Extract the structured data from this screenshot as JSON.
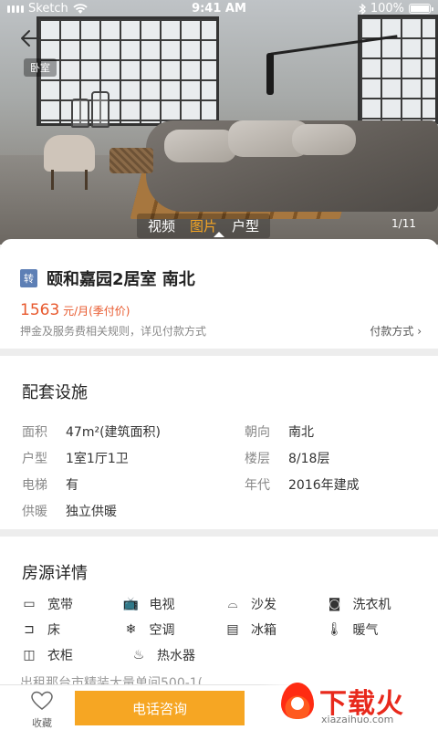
{
  "status_bar": {
    "carrier": "Sketch",
    "time": "9:41 AM",
    "battery": "100%",
    "battery_level": 1.0
  },
  "hero": {
    "room_tag": "卧室",
    "media_tabs": [
      {
        "label": "视频",
        "active": false
      },
      {
        "label": "图片",
        "active": true
      },
      {
        "label": "户型",
        "active": false
      }
    ],
    "counter": "1/11"
  },
  "listing": {
    "badge": "转",
    "title": "颐和嘉园2居室 南北",
    "price": "1563",
    "price_unit": " 元/月(季付价)",
    "policy_text": "押金及服务费相关规则，详见付款方式",
    "pay_link": "付款方式 ›"
  },
  "facilities": {
    "title": "配套设施",
    "rows": [
      [
        {
          "label": "面积",
          "value": "47m²(建筑面积)"
        },
        {
          "label": "朝向",
          "value": "南北"
        }
      ],
      [
        {
          "label": "户型",
          "value": "1室1厅1卫"
        },
        {
          "label": "楼层",
          "value": "8/18层"
        }
      ],
      [
        {
          "label": "电梯",
          "value": "有"
        },
        {
          "label": "年代",
          "value": "2016年建成"
        }
      ],
      [
        {
          "label": "供暖",
          "value": "独立供暖"
        }
      ]
    ]
  },
  "details": {
    "title": "房源详情",
    "amenities": [
      [
        {
          "icon": "broadband-icon",
          "glyph": "▭",
          "label": "宽带"
        },
        {
          "icon": "tv-icon",
          "glyph": "📺",
          "label": "电视"
        },
        {
          "icon": "sofa-icon",
          "glyph": "⌓",
          "label": "沙发"
        },
        {
          "icon": "washer-icon",
          "glyph": "◙",
          "label": "洗衣机"
        }
      ],
      [
        {
          "icon": "bed-icon",
          "glyph": "⊐",
          "label": "床"
        },
        {
          "icon": "ac-icon",
          "glyph": "❄",
          "label": "空调"
        },
        {
          "icon": "fridge-icon",
          "glyph": "▤",
          "label": "冰箱"
        },
        {
          "icon": "heater-icon",
          "glyph": "🌡",
          "label": "暖气"
        }
      ],
      [
        {
          "icon": "wardrobe-icon",
          "glyph": "◫",
          "label": "衣柜"
        },
        {
          "icon": "water-heater-icon",
          "glyph": "♨",
          "label": "热水器"
        }
      ]
    ],
    "description": "出租那台市精装大量单间500-1("
  },
  "bottom_bar": {
    "fav_label": "收藏",
    "call_label": "电话咨询"
  },
  "watermark": {
    "brand": "下载火",
    "url": "xiazaihuo.com"
  }
}
